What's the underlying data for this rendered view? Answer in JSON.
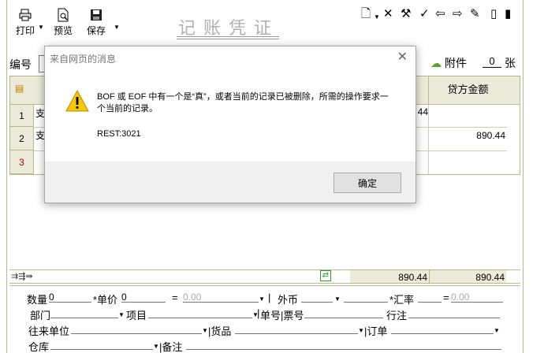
{
  "toolbar": {
    "print_label": "打印",
    "preview_label": "预览",
    "save_label": "保存",
    "title": "记账凭证"
  },
  "header": {
    "voucher_no_label": "编号",
    "attachment_label": "附件",
    "attachment_count": "0",
    "attachment_unit": "张"
  },
  "grid": {
    "credit_header": "贷方金额",
    "rows": [
      {
        "num": "1",
        "text": "支",
        "debit": "44",
        "credit": ""
      },
      {
        "num": "2",
        "text": "支",
        "debit": "",
        "credit": "890.44"
      },
      {
        "num": "3",
        "text": "",
        "debit": "",
        "credit": ""
      }
    ],
    "total_debit": "890.44",
    "total_credit": "890.44"
  },
  "form": {
    "qty_label": "数量",
    "qty_value": "0",
    "unit_price_label": "*单价",
    "unit_price_value": "0",
    "equals": "=",
    "amount_value": "0.00",
    "currency_label": "外币",
    "rate_label": "*汇率",
    "rate_result": "0.00",
    "dept_label": "部门",
    "project_label": "项目",
    "doc_no_label": "单号|票号",
    "bank_label": "行注",
    "partner_label": "往来单位",
    "goods_label": "货品",
    "order_label": "订单",
    "warehouse_label": "仓库",
    "note_label": "备注"
  },
  "dialog": {
    "title": "来自网页的消息",
    "message": "BOF 或 EOF 中有一个是“真”，或者当前的记录已被删除，所需的操作要求一个当前的记录。",
    "code": "REST:3021",
    "ok_label": "确定"
  }
}
